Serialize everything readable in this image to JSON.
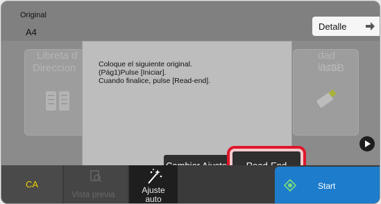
{
  "header": {
    "original_label": "Original",
    "original_value": "A4",
    "detail_label": "Detalle"
  },
  "tiles": {
    "left_line1": "Libreta d",
    "left_line2": "Direccion",
    "right_line1": "dad local",
    "right_line2": "/USB"
  },
  "dialog": {
    "line1": "Coloque el siguiente original.",
    "line2": "(Pág1)Pulse [Iniciar].",
    "line3": "Cuando finalice, pulse [Read-end].",
    "change_label": "Cambiar Ajuste",
    "readend_label": "Read-End"
  },
  "bottom": {
    "ca_label": "CA",
    "preview_label": "Vista previa",
    "auto_line1": "Ajuste",
    "auto_line2": "auto",
    "start_label": "Start"
  },
  "colors": {
    "accent": "#1d7ccc",
    "highlight": "#e0162a",
    "ca_text": "#f0d000"
  },
  "icons": [
    "arrow-right-icon",
    "address-book-icon",
    "usb-icon",
    "play-icon",
    "preview-icon",
    "magic-wand-icon",
    "start-icon"
  ]
}
